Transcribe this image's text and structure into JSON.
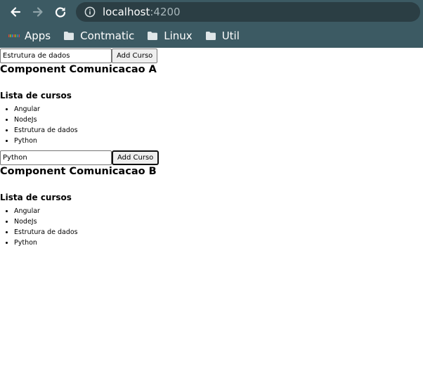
{
  "browser": {
    "url_host": "localhost",
    "url_port": ":4200",
    "bookmarks": [
      {
        "label": "Apps",
        "icon": "apps-grid-icon"
      },
      {
        "label": "Contmatic",
        "icon": "folder-icon"
      },
      {
        "label": "Linux",
        "icon": "folder-icon"
      },
      {
        "label": "Util",
        "icon": "folder-icon"
      }
    ]
  },
  "components": [
    {
      "input_value": "Estrutura de dados",
      "button_label": "Add Curso",
      "title": "Component Comunicacao A",
      "list_title": "Lista de cursos",
      "courses": [
        "Angular",
        "NodeJs",
        "Estrutura de dados",
        "Python"
      ]
    },
    {
      "input_value": "Python",
      "button_label": "Add Curso",
      "title": "Component Comunicacao B",
      "list_title": "Lista de cursos",
      "courses": [
        "Angular",
        "NodeJs",
        "Estrutura de dados",
        "Python"
      ]
    }
  ],
  "colors": {
    "chrome_bg": "#3c5a63",
    "omnibox_bg": "#2b3e44"
  }
}
